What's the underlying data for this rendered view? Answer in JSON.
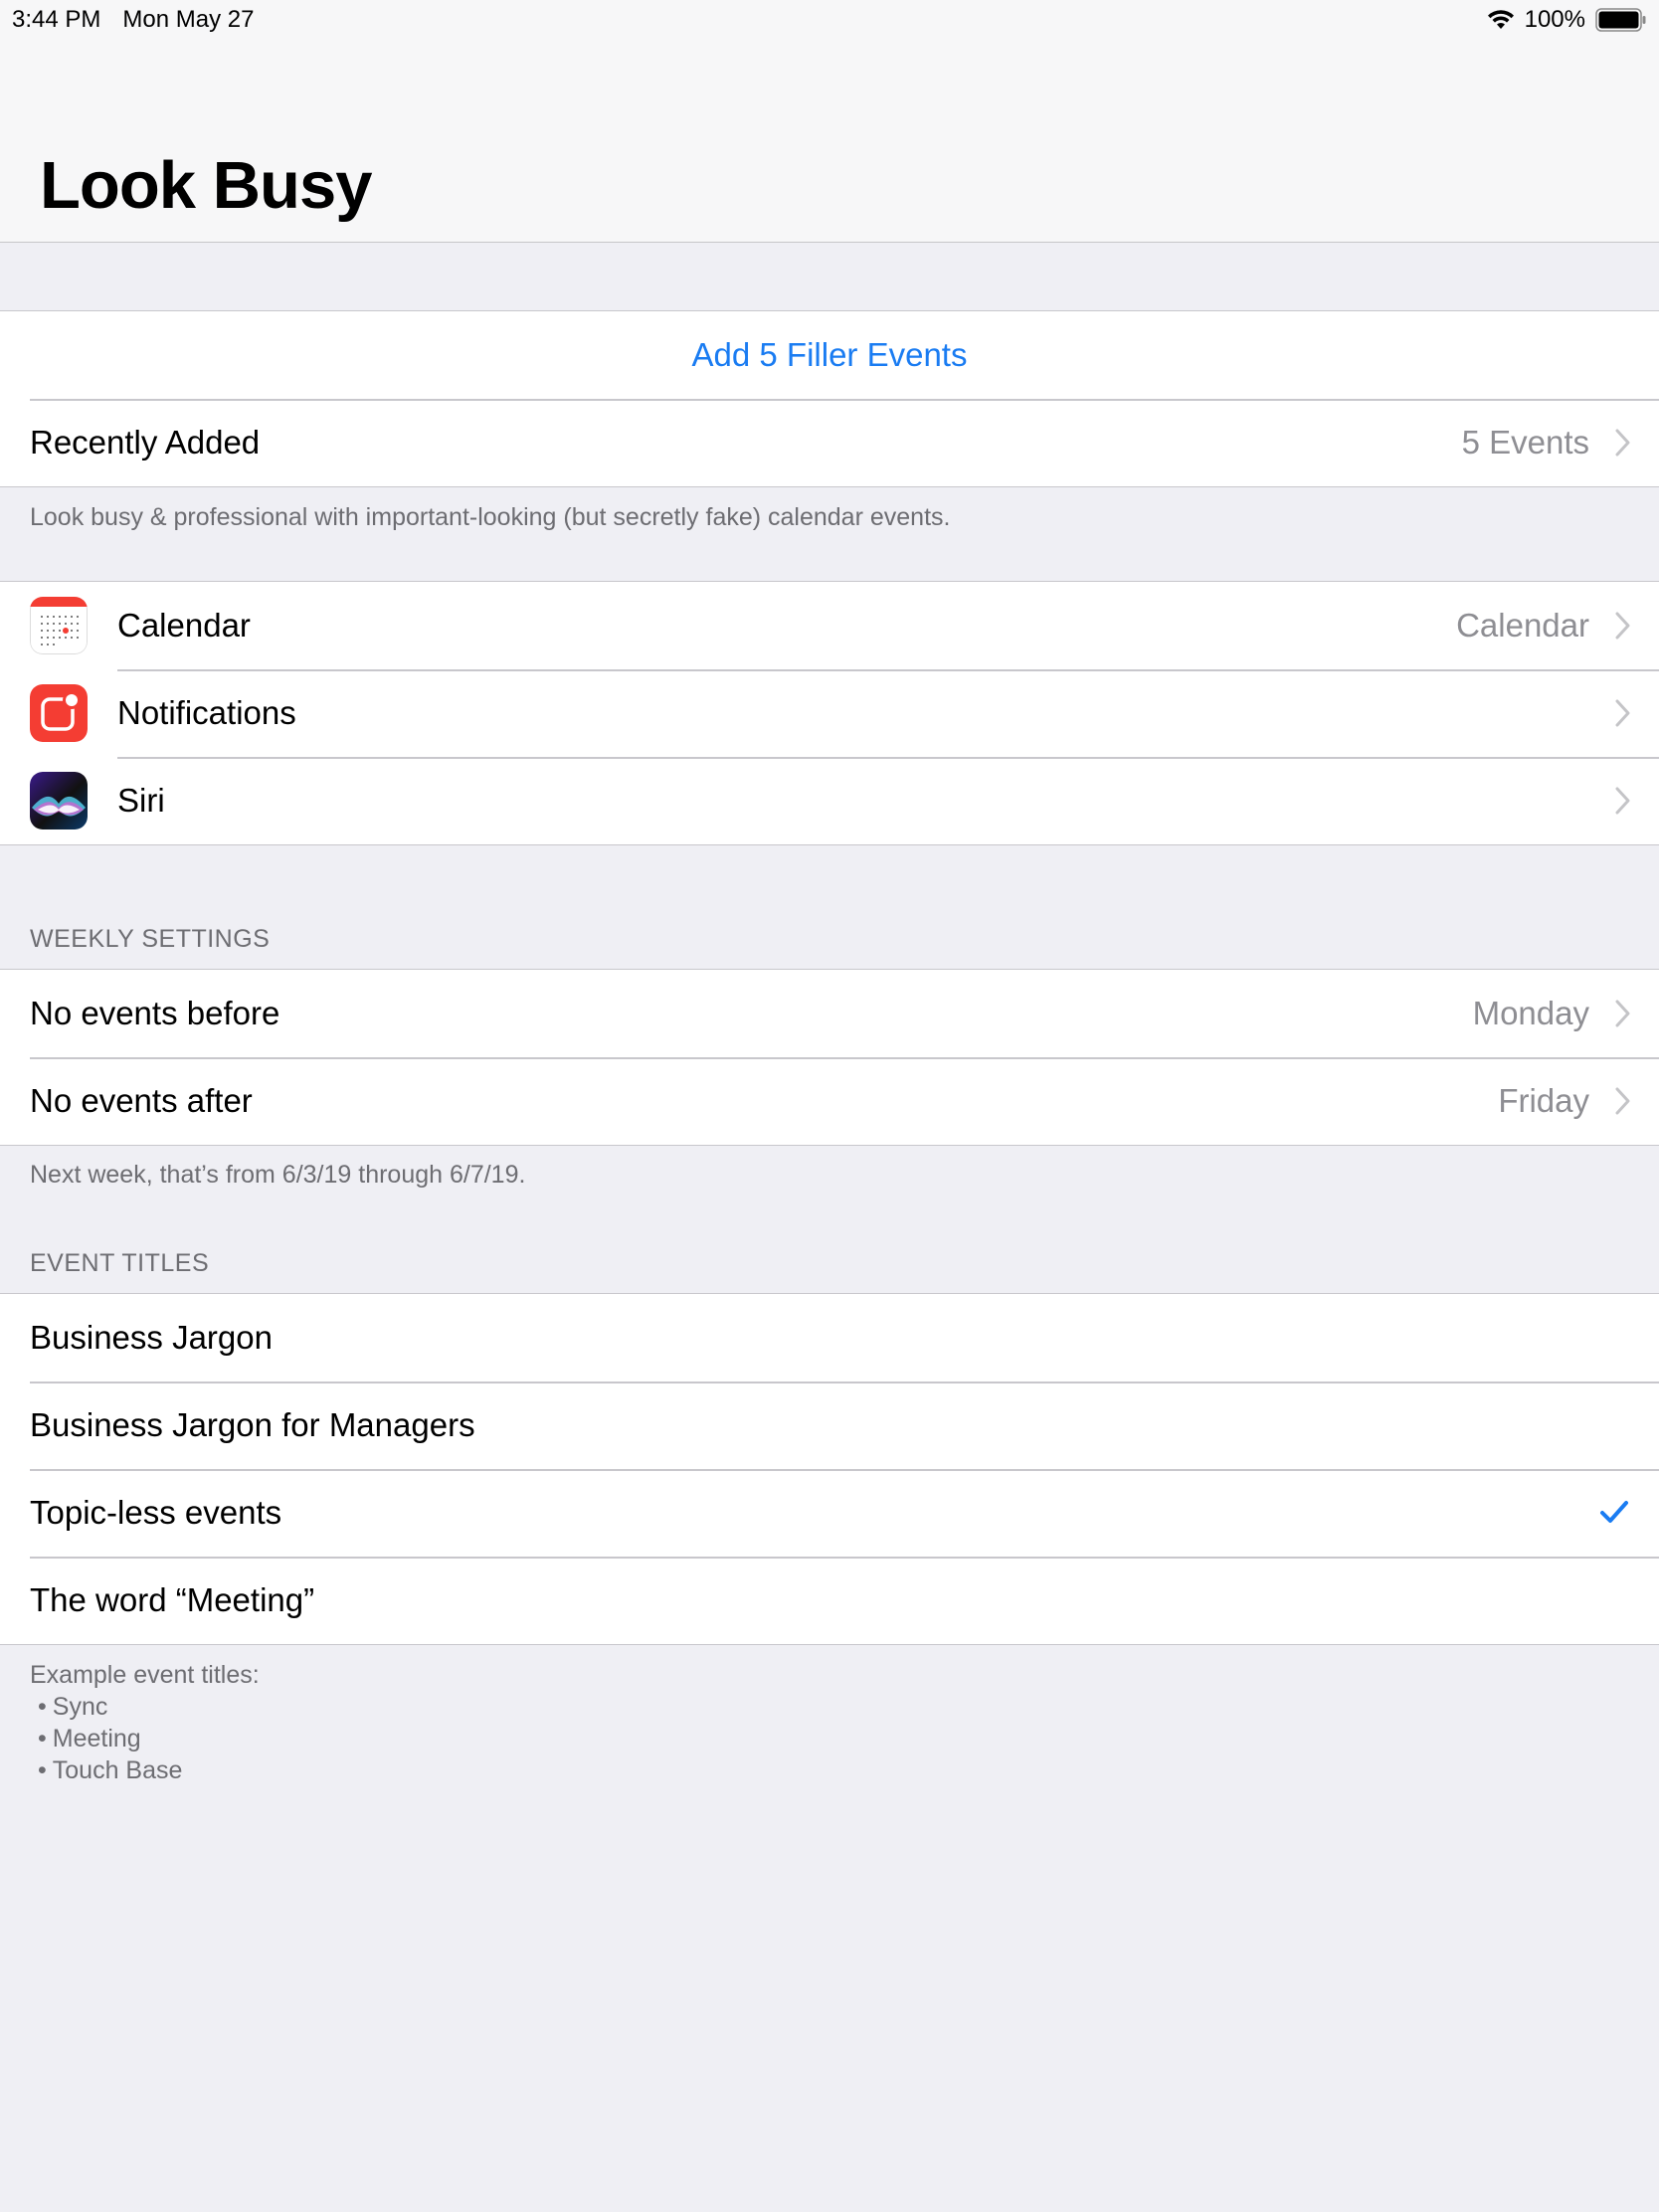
{
  "status_bar": {
    "time": "3:44 PM",
    "date": "Mon May 27",
    "battery": "100%",
    "battery_level": 1.0
  },
  "nav": {
    "title": "Look Busy"
  },
  "actions": {
    "add_button_label": "Add 5 Filler Events",
    "recently_added_label": "Recently Added",
    "recently_added_value": "5 Events",
    "footer": "Look busy & professional with important-looking (but secretly fake) calendar events."
  },
  "integrations": {
    "items": [
      {
        "label": "Calendar",
        "value": "Calendar",
        "icon": "calendar-app-icon"
      },
      {
        "label": "Notifications",
        "value": "",
        "icon": "notifications-app-icon"
      },
      {
        "label": "Siri",
        "value": "",
        "icon": "siri-app-icon"
      }
    ]
  },
  "weekly": {
    "header": "WEEKLY SETTINGS",
    "items": [
      {
        "label": "No events before",
        "value": "Monday"
      },
      {
        "label": "No events after",
        "value": "Friday"
      }
    ],
    "footer": "Next week, that’s from 6/3/19 through 6/7/19."
  },
  "event_titles": {
    "header": "EVENT TITLES",
    "items": [
      {
        "label": "Business Jargon",
        "checked": false
      },
      {
        "label": "Business Jargon for Managers",
        "checked": false
      },
      {
        "label": "Topic-less events",
        "checked": true
      },
      {
        "label": "The word “Meeting”",
        "checked": false
      }
    ],
    "footer_title": "Example event titles:",
    "examples": [
      "Sync",
      "Meeting",
      "Touch Base"
    ]
  },
  "colors": {
    "accent": "#1a7cf2",
    "background": "#efeff4",
    "secondary_text": "#8e8e93"
  }
}
